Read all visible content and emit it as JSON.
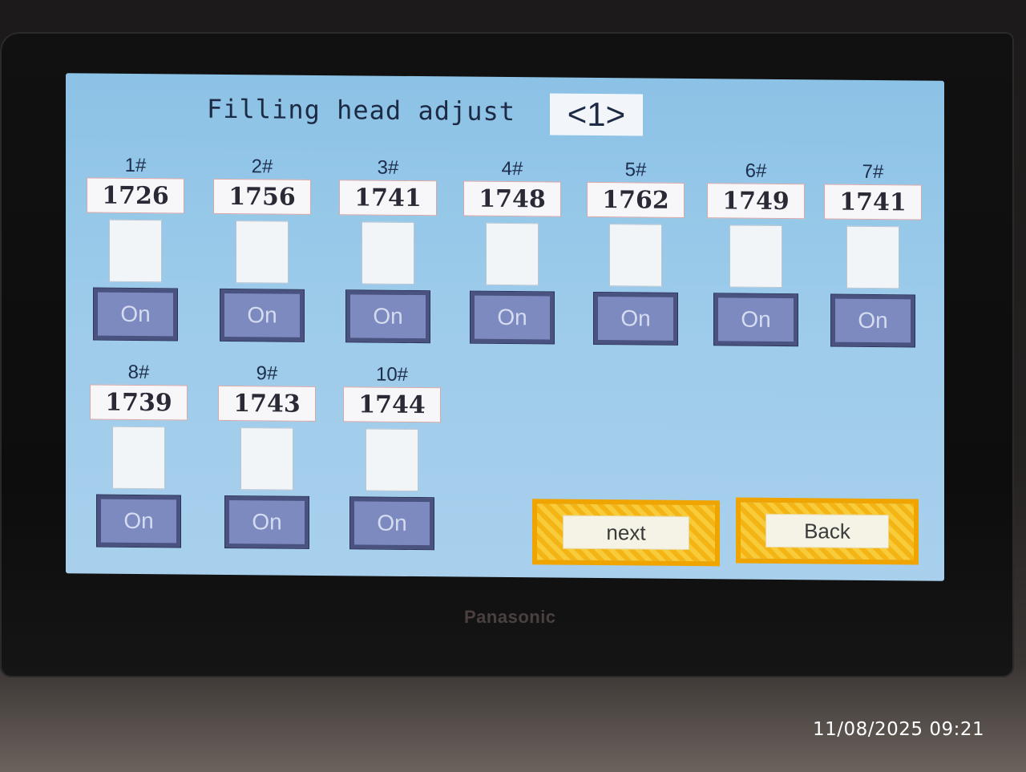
{
  "screen": {
    "title": "Filling head adjust",
    "page_indicator": "<1>"
  },
  "heads": [
    {
      "label": "1#",
      "value": "1726",
      "button": "On"
    },
    {
      "label": "2#",
      "value": "1756",
      "button": "On"
    },
    {
      "label": "3#",
      "value": "1741",
      "button": "On"
    },
    {
      "label": "4#",
      "value": "1748",
      "button": "On"
    },
    {
      "label": "5#",
      "value": "1762",
      "button": "On"
    },
    {
      "label": "6#",
      "value": "1749",
      "button": "On"
    },
    {
      "label": "7#",
      "value": "1741",
      "button": "On"
    },
    {
      "label": "8#",
      "value": "1739",
      "button": "On"
    },
    {
      "label": "9#",
      "value": "1743",
      "button": "On"
    },
    {
      "label": "10#",
      "value": "1744",
      "button": "On"
    }
  ],
  "nav": {
    "next_label": "next",
    "back_label": "Back"
  },
  "device": {
    "brand": "Panasonic"
  },
  "photo": {
    "timestamp": "11/08/2025 09:21"
  }
}
